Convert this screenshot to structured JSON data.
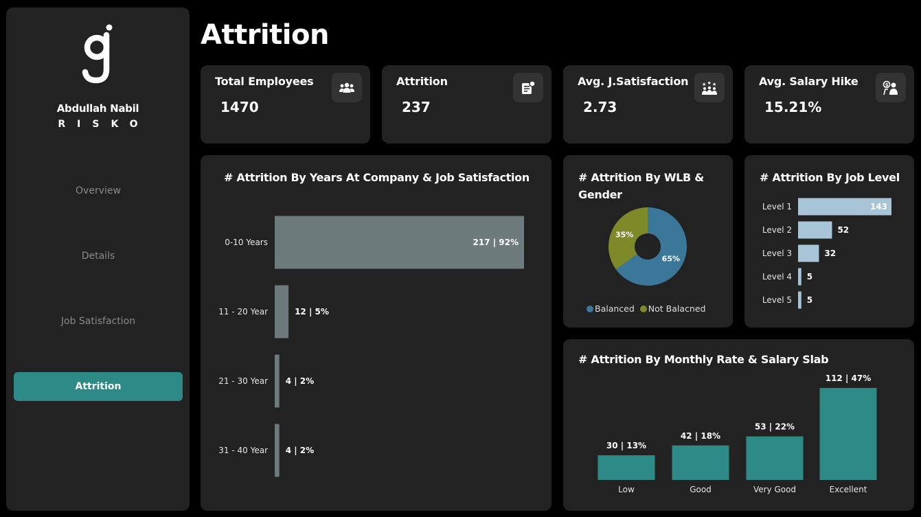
{
  "brand": {
    "name": "Abdullah Nabil",
    "sub": "RISKO"
  },
  "page": {
    "title": "Attrition"
  },
  "nav": [
    {
      "label": "Overview"
    },
    {
      "label": "Details"
    },
    {
      "label": "Job Satisfaction"
    },
    {
      "label": "Attrition",
      "active": true
    }
  ],
  "kpis": [
    {
      "label": "Total Employees",
      "value": "1470",
      "icon": "people-group-icon"
    },
    {
      "label": "Attrition",
      "value": "237",
      "icon": "document-badge-icon"
    },
    {
      "label": "Avg. J.Satisfaction",
      "value": "2.73",
      "icon": "stars-people-icon"
    },
    {
      "label": "Avg. Salary Hike",
      "value": "15.21%",
      "icon": "money-person-icon"
    }
  ],
  "colors": {
    "accent": "#2e8a86",
    "bar_grey": "#6e7b7d",
    "bar_blue": "#a8c5d8",
    "pie_blue": "#3b7799",
    "pie_olive": "#7e8a2a"
  },
  "chart_data": [
    {
      "type": "bar",
      "orientation": "horizontal",
      "title": "# Attrition By Years At Company & Job Satisfaction",
      "categories": [
        "0-10 Years",
        "11 - 20 Year",
        "21 - 30 Year",
        "31 - 40 Year"
      ],
      "values": [
        217,
        12,
        4,
        4
      ],
      "labels": [
        "217  |  92%",
        "12  |  5%",
        "4  |  2%",
        "4  |  2%"
      ]
    },
    {
      "type": "pie",
      "title": "# Attrition By WLB & Gender",
      "categories": [
        "Balanced",
        "Not Balacned"
      ],
      "values": [
        65,
        35
      ],
      "labels": [
        "65%",
        "35%"
      ],
      "legend": "bottom"
    },
    {
      "type": "bar",
      "orientation": "horizontal",
      "title": "# Attrition By Job Level",
      "categories": [
        "Level 1",
        "Level 2",
        "Level 3",
        "Level 4",
        "Level 5"
      ],
      "values": [
        143,
        52,
        32,
        5,
        5
      ],
      "labels": [
        "143",
        "52",
        "32",
        "5",
        "5"
      ]
    },
    {
      "type": "bar",
      "orientation": "vertical",
      "title": "# Attrition By Monthly Rate & Salary Slab",
      "categories": [
        "Low",
        "Good",
        "Very Good",
        "Excellent"
      ],
      "values": [
        30,
        42,
        53,
        112
      ],
      "labels": [
        "30  |  13%",
        "42  |  18%",
        "53  |  22%",
        "112  |  47%"
      ]
    }
  ]
}
